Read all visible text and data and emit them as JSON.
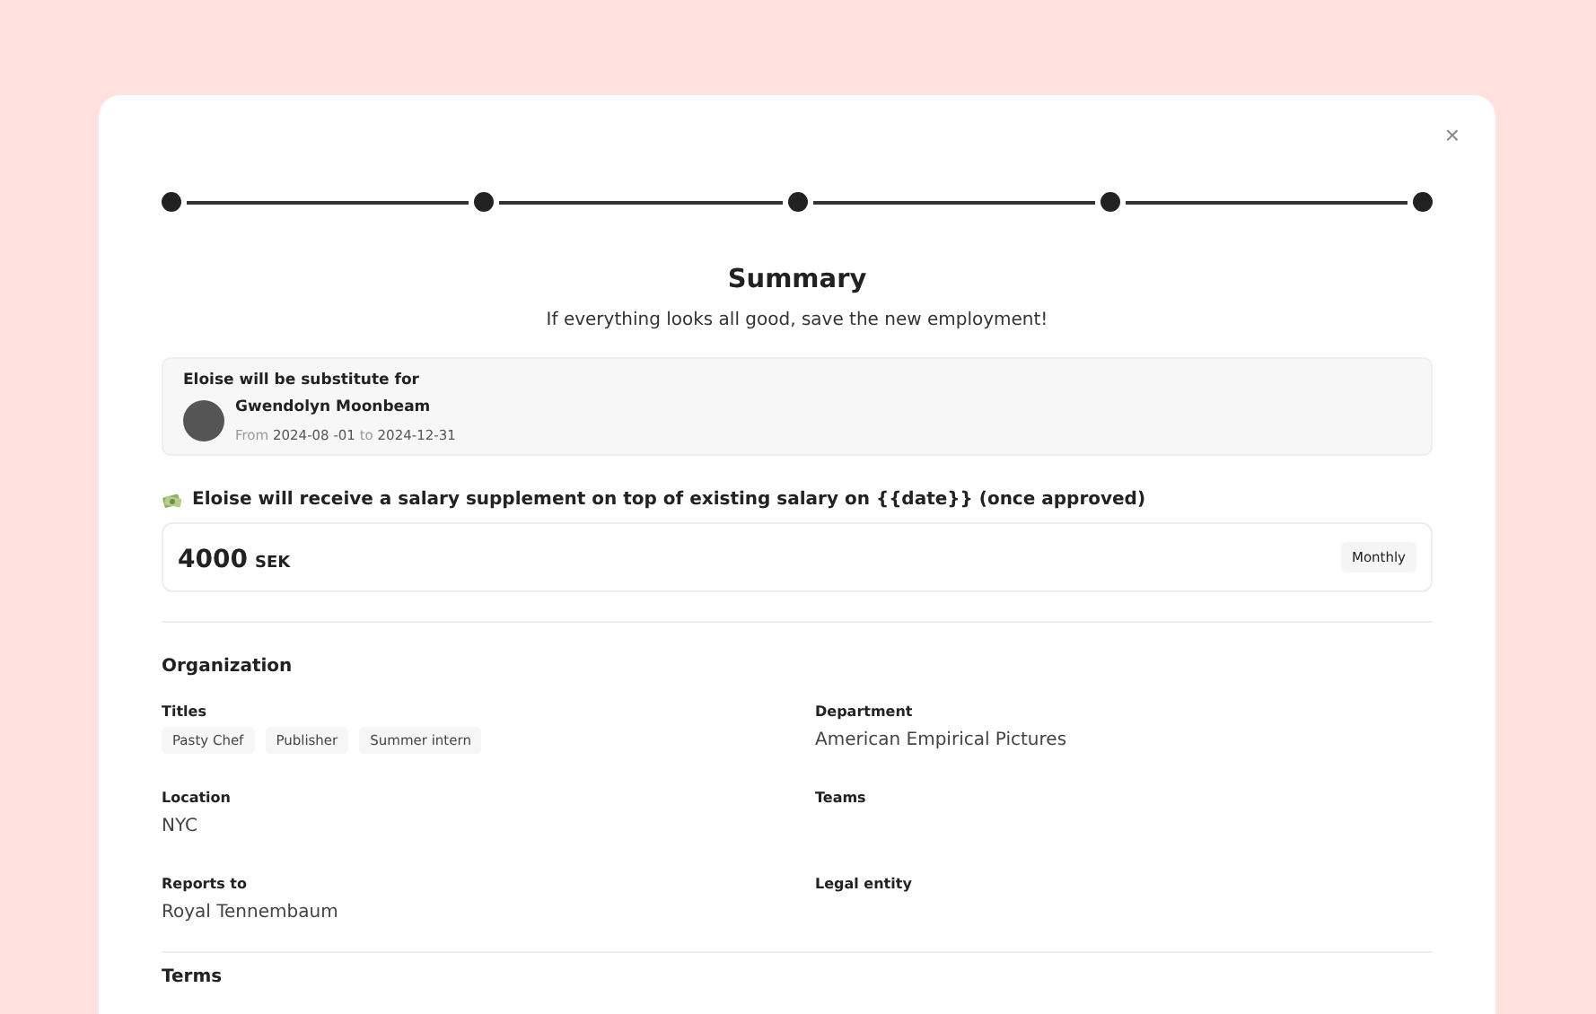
{
  "close": "×",
  "stepper": [
    {
      "completed": true
    },
    {
      "completed": true
    },
    {
      "completed": true
    },
    {
      "completed": true
    },
    {
      "completed": true
    }
  ],
  "title": "Summary",
  "subtitle": "If everything looks all good, save the new employment!",
  "substitute": {
    "heading": "Eloise will be substitute for",
    "name": "Gwendolyn Moonbeam",
    "from_label": "From",
    "from": "2024-08 -01",
    "to_label": "to",
    "to": "2024-12-31"
  },
  "supplement": {
    "heading": "Eloise will receive a salary supplement on top of existing salary on {{date}} (once approved)",
    "amount": "4000",
    "currency": "SEK",
    "period": "Monthly"
  },
  "organization": {
    "heading": "Organization",
    "fields": [
      {
        "label": "Titles",
        "kind": "tags",
        "tags": [
          "Pasty Chef",
          "Publisher",
          "Summer intern"
        ]
      },
      {
        "label": "Department",
        "kind": "text",
        "value": "American Empirical Pictures"
      },
      {
        "label": "Location",
        "kind": "text",
        "value": "NYC"
      },
      {
        "label": "Teams",
        "kind": "text"
      },
      {
        "label": "Reports to",
        "kind": "text",
        "value": "Royal Tennembaum"
      },
      {
        "label": "Legal entity",
        "kind": "text"
      }
    ]
  },
  "next_section": "Terms"
}
